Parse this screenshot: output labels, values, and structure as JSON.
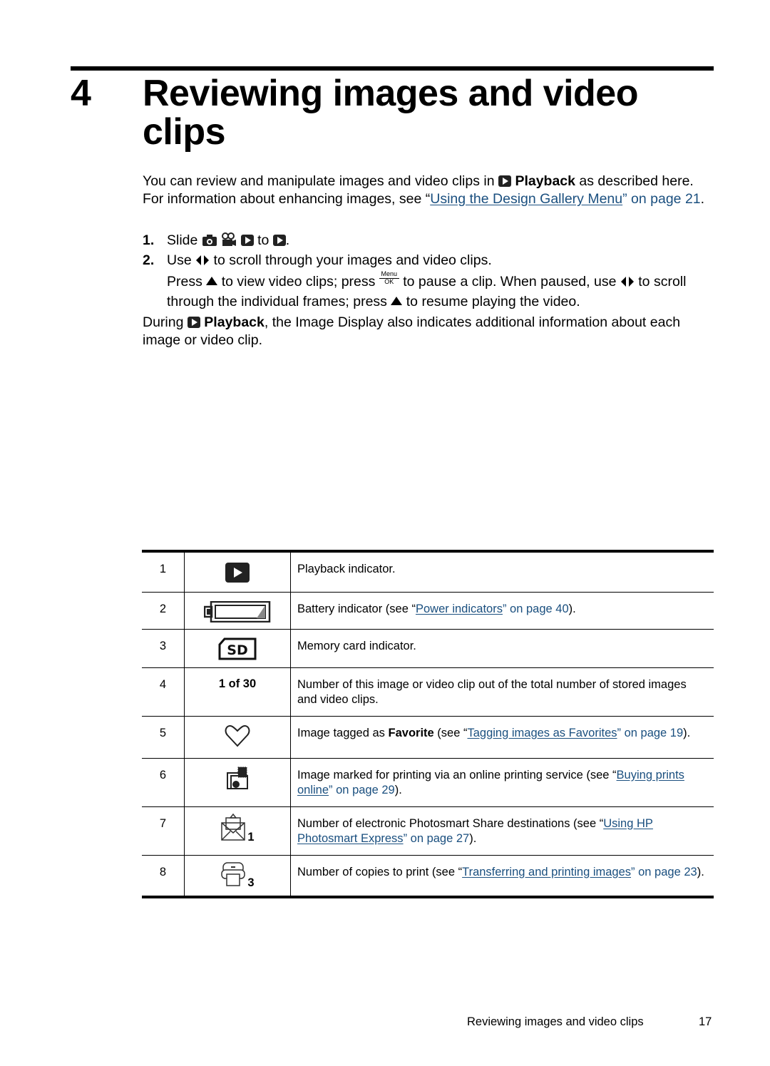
{
  "chapter": {
    "number": "4",
    "title": "Reviewing images and video clips"
  },
  "intro": {
    "p1_a": "You can review and manipulate images and video clips in",
    "p1_bold": "Playback",
    "p1_b": "as described here. For information about enhancing images, see “",
    "p1_link": "Using the Design Gallery Menu",
    "p1_c": "” on page 21",
    "p1_end": "."
  },
  "steps": [
    {
      "num": "1.",
      "a": "Slide",
      "to": "to",
      "end": "."
    },
    {
      "num": "2.",
      "a": "Use",
      "b": "to scroll through your images and video clips."
    }
  ],
  "step2_detail": {
    "press1": "Press",
    "t1": "to view video clips; press",
    "menu_top": "Menu",
    "menu_bottom": "OK",
    "t2": "to pause a clip. When paused, use",
    "t3": "to scroll through the individual frames; press",
    "t4": "to resume playing the video."
  },
  "during": {
    "a": "During",
    "bold": "Playback",
    "b": ", the Image Display also indicates additional information about each image or video clip."
  },
  "table": {
    "rows": [
      {
        "num": "1",
        "icon": "playback-icon",
        "text": "Playback indicator."
      },
      {
        "num": "2",
        "icon": "battery-icon",
        "pre": "Battery indicator (see “",
        "link": "Power indicators",
        "post": "” on page 40",
        "end": ")."
      },
      {
        "num": "3",
        "icon": "sd-card-icon",
        "text": "Memory card indicator."
      },
      {
        "num": "4",
        "label": "1 of 30",
        "text": "Number of this image or video clip out of the total number of stored images and video clips."
      },
      {
        "num": "5",
        "icon": "heart-icon",
        "pre": "Image tagged as ",
        "bold": "Favorite",
        "mid": " (see “",
        "link": "Tagging images as Favorites",
        "post": "” on page 19",
        "end": ")."
      },
      {
        "num": "6",
        "icon": "online-print-icon",
        "pre": "Image marked for printing via an online printing service (see “",
        "link": "Buying prints online",
        "post": "” on page 29",
        "end": ")."
      },
      {
        "num": "7",
        "icon": "share-envelope-icon",
        "count": "1",
        "pre": "Number of electronic Photosmart Share destinations (see “",
        "link": "Using HP Photosmart Express",
        "post": "” on page 27",
        "end": ")."
      },
      {
        "num": "8",
        "icon": "printer-icon",
        "count": "3",
        "pre": "Number of copies to print (see “",
        "link": "Transferring and printing images",
        "post": "” on page 23",
        "end": ")."
      }
    ]
  },
  "footer": {
    "title": "Reviewing images and video clips",
    "page": "17"
  },
  "colors": {
    "link": "#1a4f7f",
    "text": "#000000"
  }
}
